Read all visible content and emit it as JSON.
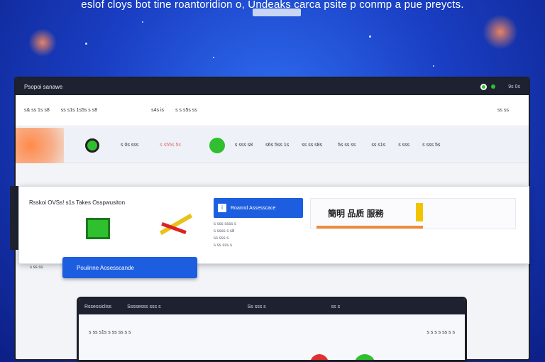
{
  "headline": "eslof cloys  bot tine roantoridion  o, Undeaks carca  psite p conmp a pue preycts.",
  "headline_badge": "",
  "window": {
    "title": "Psopoi sanawe",
    "right_label": "9s 0s",
    "toolbar": [
      "s& ss 1s s8",
      "ss s1s 1s5s s s8",
      "s4s is",
      "s s s5s ss"
    ],
    "toolbar_right": "ss ss",
    "row_cells": [
      "s 0s sss",
      "s s55s 5s",
      "s sss s8",
      "s6s 5ss 1s",
      "ss ss s8s",
      "5s ss ss",
      "ss s1s",
      "s sss",
      "s sss 5s"
    ]
  },
  "card": {
    "title": "Rsskoi OVSs! s1s  Takes Osspwusiton",
    "button_label": "Roannd Assesscace",
    "list": [
      "s sss ssss s",
      "s ssss s s8",
      "ss sss s",
      "s ss sss s"
    ],
    "banner_text": "簡明 品质 服務"
  },
  "blue_button": "Pouiinne Aosesscande",
  "side_label": "s ss ss",
  "window2": {
    "tabs": [
      "Rssessicliss",
      "Ssssesss sss s",
      "Ss sss s",
      "ss s"
    ],
    "row_left": "s ss s1s s ss ss s s",
    "row_right": "s s s s ss s s"
  },
  "colors": {
    "accent": "#1d5ee0",
    "background": "#1a3fc4",
    "window_dark": "#1e2230",
    "green": "#2fbf2f",
    "orange": "#f08a3c"
  }
}
